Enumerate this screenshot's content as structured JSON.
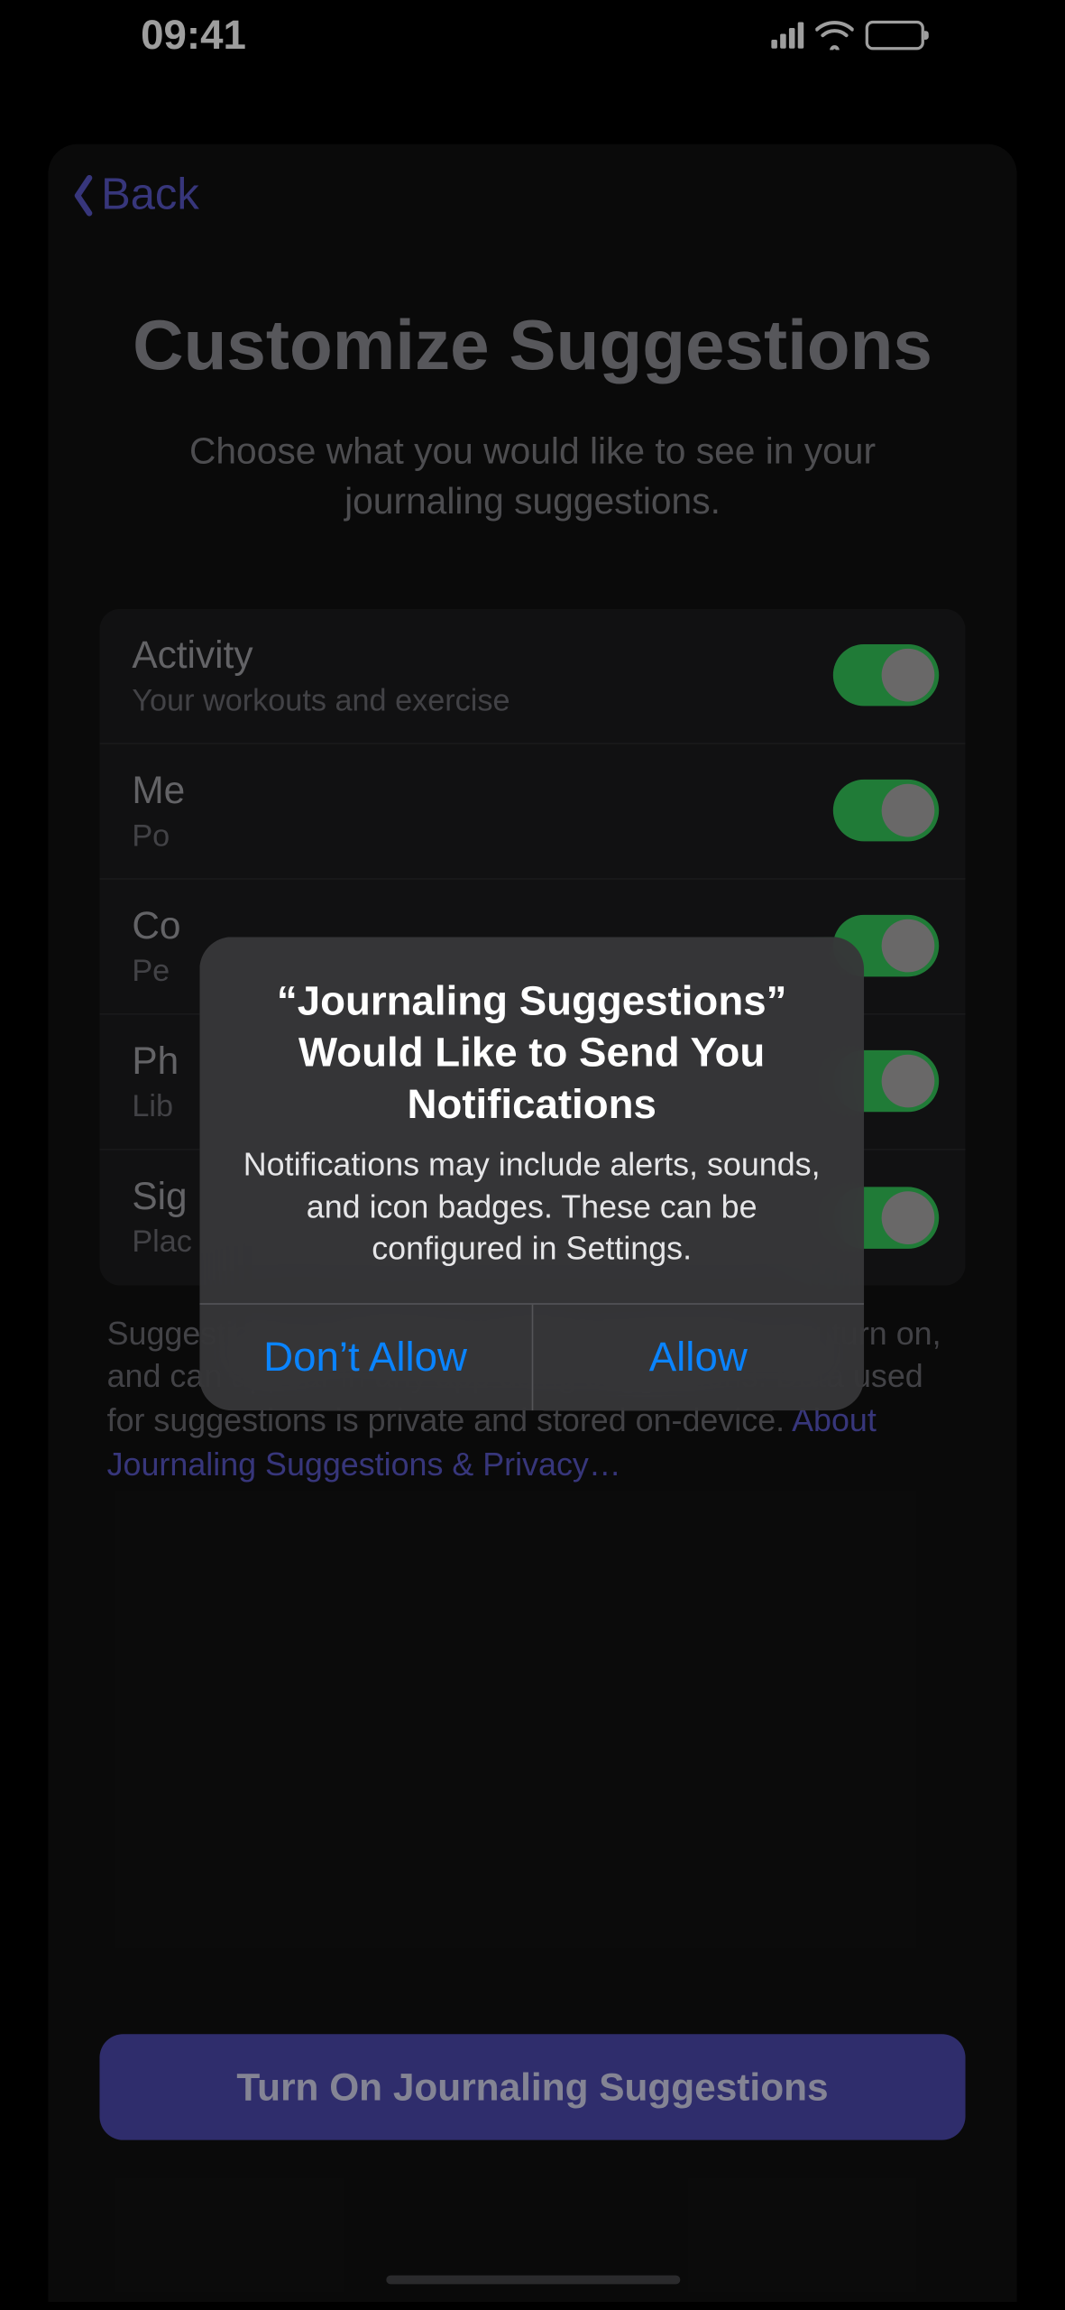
{
  "status": {
    "time": "09:41"
  },
  "nav": {
    "back": "Back"
  },
  "page": {
    "title": "Customize Suggestions",
    "subtitle": "Choose what you would like to see in your journaling suggestions."
  },
  "rows": [
    {
      "title": "Activity",
      "sub": "Your workouts and exercise"
    },
    {
      "title": "Me",
      "sub": "Po"
    },
    {
      "title": "Co",
      "sub": "Pe"
    },
    {
      "title": "Ph",
      "sub": "Lib"
    },
    {
      "title": "Sig",
      "sub": "Plac"
    }
  ],
  "footer": {
    "text": "Suggestions use data from apps and services you turn on, and can appear in any app using suggestions. Data used for suggestions is private and stored on-device. ",
    "link": "About Journaling Suggestions & Privacy…"
  },
  "cta": "Turn On Journaling Suggestions",
  "alert": {
    "title": "“Journaling Suggestions” Would Like to Send You Notifications",
    "message": "Notifications may include alerts, sounds, and icon badges. These can be configured in Settings.",
    "deny": "Don’t Allow",
    "allow": "Allow"
  }
}
